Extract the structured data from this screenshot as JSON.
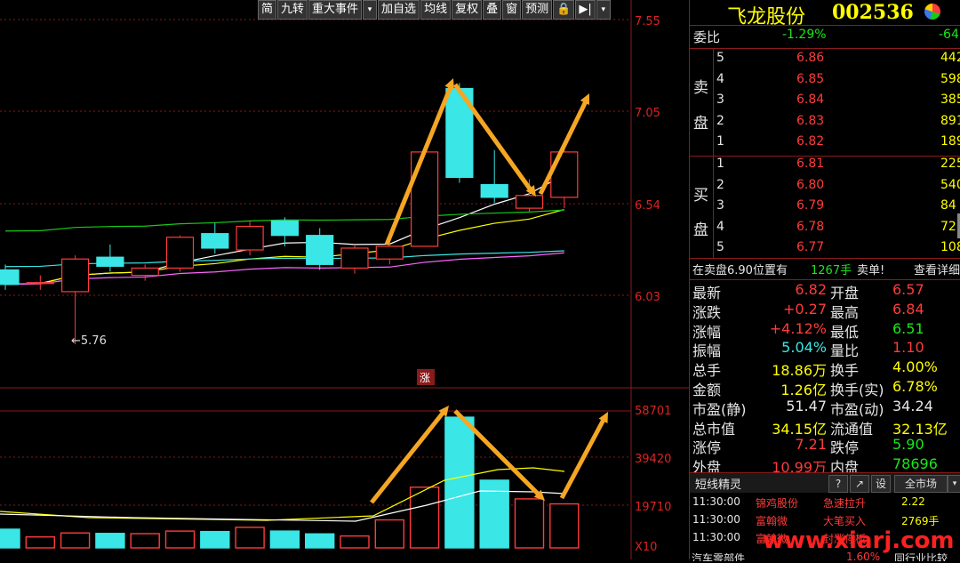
{
  "toolbar": {
    "items": [
      "简",
      "九转",
      "重大事件",
      "▾",
      "加自选",
      "均线",
      "复权",
      "叠",
      "窗",
      "预测",
      "🔒",
      "▶|",
      "▾"
    ]
  },
  "chart": {
    "price_axis": [
      "7.55",
      "7.05",
      "6.54",
      "6.03"
    ],
    "volume_axis": [
      "58701",
      "39420",
      "19710",
      "X10"
    ],
    "low_marker": "←5.76",
    "rise_badge": "涨"
  },
  "header": {
    "name": "飞龙股份",
    "code": "002536"
  },
  "weibi": {
    "label": "委比",
    "pct": "-1.29%",
    "diff": "-64"
  },
  "sell": {
    "label_a": "卖",
    "label_b": "盘",
    "rows": [
      {
        "lvl": "5",
        "price": "6.86",
        "vol": "442"
      },
      {
        "lvl": "4",
        "price": "6.85",
        "vol": "598"
      },
      {
        "lvl": "3",
        "price": "6.84",
        "vol": "385"
      },
      {
        "lvl": "2",
        "price": "6.83",
        "vol": "891"
      },
      {
        "lvl": "1",
        "price": "6.82",
        "vol": "189"
      }
    ]
  },
  "buy": {
    "label_a": "买",
    "label_b": "盘",
    "rows": [
      {
        "lvl": "1",
        "price": "6.81",
        "vol": "225"
      },
      {
        "lvl": "2",
        "price": "6.80",
        "vol": "540"
      },
      {
        "lvl": "3",
        "price": "6.79",
        "vol": "84"
      },
      {
        "lvl": "4",
        "price": "6.78",
        "vol": "72"
      },
      {
        "lvl": "5",
        "price": "6.77",
        "vol": "108"
      }
    ]
  },
  "notice": {
    "prefix": "在卖盘6.90位置有",
    "qty": "1267手",
    "suffix": "卖单!",
    "link": "查看详细"
  },
  "stats": [
    {
      "l1": "最新",
      "v1": "6.82",
      "c1": "red",
      "l2": "开盘",
      "v2": "6.57",
      "c2": "red"
    },
    {
      "l1": "涨跌",
      "v1": "+0.27",
      "c1": "red",
      "l2": "最高",
      "v2": "6.84",
      "c2": "red"
    },
    {
      "l1": "涨幅",
      "v1": "+4.12%",
      "c1": "red",
      "l2": "最低",
      "v2": "6.51",
      "c2": "green"
    },
    {
      "l1": "振幅",
      "v1": "5.04%",
      "c1": "cyan",
      "l2": "量比",
      "v2": "1.10",
      "c2": "red"
    },
    {
      "l1": "总手",
      "v1": "18.86万",
      "c1": "yellow",
      "l2": "换手",
      "v2": "4.00%",
      "c2": "yellow"
    },
    {
      "l1": "金额",
      "v1": "1.26亿",
      "c1": "yellow",
      "l2": "换手(实)",
      "v2": "6.78%",
      "c2": "yellow"
    },
    {
      "l1": "市盈(静)",
      "v1": "51.47",
      "c1": "white",
      "l2": "市盈(动)",
      "v2": "34.24",
      "c2": "white"
    },
    {
      "l1": "总市值",
      "v1": "34.15亿",
      "c1": "yellow",
      "l2": "流通值",
      "v2": "32.13亿",
      "c2": "yellow"
    },
    {
      "l1": "涨停",
      "v1": "7.21",
      "c1": "red",
      "l2": "跌停",
      "v2": "5.90",
      "c2": "green"
    },
    {
      "l1": "外盘",
      "v1": "10.99万",
      "c1": "red",
      "l2": "内盘",
      "v2": "78696",
      "c2": "green"
    }
  ],
  "sprite": {
    "title": "短线精灵",
    "help": "?",
    "popout": "↗",
    "settings": "设",
    "scope": "全市场",
    "scope_arrow": "▾",
    "rows": [
      {
        "time": "11:30:00",
        "name": "锦鸡股份",
        "event": "急速拉升",
        "val": "2.22"
      },
      {
        "time": "11:30:00",
        "name": "富翰微",
        "event": "大笔买入",
        "val": "2769手"
      },
      {
        "time": "11:30:00",
        "name": "富翰微",
        "event": "封涨停板",
        "val": ""
      }
    ],
    "footer_left": "汽车零部件",
    "footer_mid": "1.60%",
    "footer_right": "同行业比较"
  },
  "watermark": "www.xiarj.com",
  "colors": {
    "up": "#ff3b3b",
    "down": "#3ae6e6",
    "arrow": "#f5a623",
    "ma5": "#ffffff",
    "ma10": "#ffff00",
    "ma20": "#ff66ff",
    "ma30": "#19c819",
    "ma60": "#3ae6e6",
    "grid": "#8b1a1a"
  },
  "chart_data": {
    "type": "candlestick",
    "candles": [
      {
        "o": 6.17,
        "c": 6.09,
        "h": 6.2,
        "l": 6.06
      },
      {
        "o": 6.1,
        "c": 6.1,
        "h": 6.14,
        "l": 6.06
      },
      {
        "o": 6.05,
        "c": 6.23,
        "h": 6.25,
        "l": 5.76
      },
      {
        "o": 6.24,
        "c": 6.19,
        "h": 6.31,
        "l": 6.16
      },
      {
        "o": 6.14,
        "c": 6.18,
        "h": 6.2,
        "l": 6.11
      },
      {
        "o": 6.18,
        "c": 6.35,
        "h": 6.36,
        "l": 6.16
      },
      {
        "o": 6.37,
        "c": 6.29,
        "h": 6.43,
        "l": 6.26
      },
      {
        "o": 6.28,
        "c": 6.41,
        "h": 6.44,
        "l": 6.25
      },
      {
        "o": 6.44,
        "c": 6.36,
        "h": 6.46,
        "l": 6.3
      },
      {
        "o": 6.36,
        "c": 6.2,
        "h": 6.4,
        "l": 6.17
      },
      {
        "o": 6.18,
        "c": 6.29,
        "h": 6.31,
        "l": 6.15
      },
      {
        "o": 6.23,
        "c": 6.3,
        "h": 6.35,
        "l": 6.2
      },
      {
        "o": 6.3,
        "c": 6.82,
        "h": 6.82,
        "l": 6.3
      },
      {
        "o": 7.17,
        "c": 6.68,
        "h": 7.2,
        "l": 6.65
      },
      {
        "o": 6.64,
        "c": 6.57,
        "h": 6.83,
        "l": 6.54
      },
      {
        "o": 6.51,
        "c": 6.58,
        "h": 6.67,
        "l": 6.49
      },
      {
        "o": 6.57,
        "c": 6.82,
        "h": 6.84,
        "l": 6.51
      }
    ],
    "volume": [
      {
        "v": 8000,
        "up": false
      },
      {
        "v": 4700,
        "up": true
      },
      {
        "v": 6400,
        "up": true
      },
      {
        "v": 6200,
        "up": false
      },
      {
        "v": 6100,
        "up": true
      },
      {
        "v": 7200,
        "up": true
      },
      {
        "v": 7000,
        "up": false
      },
      {
        "v": 8800,
        "up": true
      },
      {
        "v": 7200,
        "up": false
      },
      {
        "v": 6000,
        "up": false
      },
      {
        "v": 5100,
        "up": true
      },
      {
        "v": 12000,
        "up": true
      },
      {
        "v": 26000,
        "up": true
      },
      {
        "v": 56000,
        "up": false
      },
      {
        "v": 29000,
        "up": false
      },
      {
        "v": 21000,
        "up": true
      },
      {
        "v": 18860,
        "up": true
      }
    ],
    "price_range": [
      5.6,
      7.6
    ],
    "volume_max": 58701
  }
}
